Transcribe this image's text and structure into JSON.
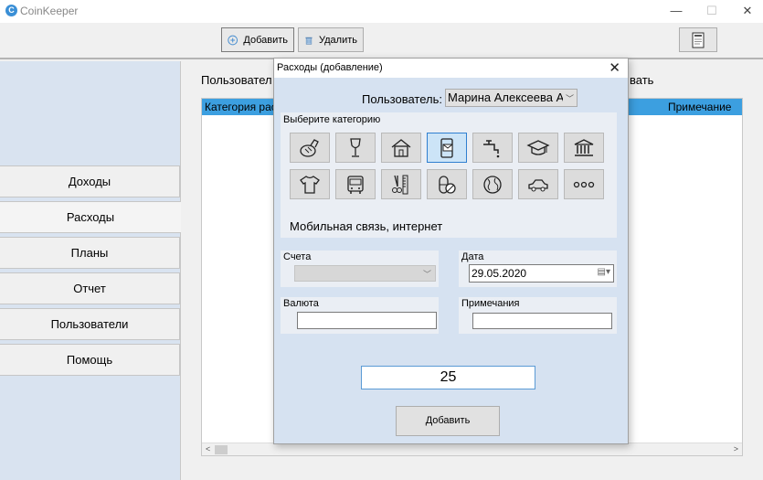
{
  "app": {
    "title": "CoinKeeper",
    "logo_letter": "C"
  },
  "window_controls": {
    "minimize": "—",
    "maximize": "☐",
    "close": "✕"
  },
  "toolbar": {
    "add_label": "Добавить",
    "delete_label": "Удалить"
  },
  "sidebar": {
    "items": [
      {
        "label": "Доходы"
      },
      {
        "label": "Расходы"
      },
      {
        "label": "Планы"
      },
      {
        "label": "Отчет"
      },
      {
        "label": "Пользователи"
      },
      {
        "label": "Помощь"
      }
    ],
    "active_index": 1
  },
  "content": {
    "label_left": "Пользовател",
    "label_right": "вать",
    "grid": {
      "columns": [
        "Категория рас",
        "Примечание"
      ],
      "scroll_left": "<",
      "scroll_right": ">"
    }
  },
  "dialog": {
    "title": "Расходы (добавление)",
    "close": "✕",
    "user_label": "Пользователь:",
    "user_value": "Марина Алексеева Ал",
    "category_label": "Выберите категорию",
    "categories": [
      {
        "icon": "bread-icon"
      },
      {
        "icon": "wine-glass-icon"
      },
      {
        "icon": "house-icon"
      },
      {
        "icon": "mobile-message-icon"
      },
      {
        "icon": "water-tap-icon"
      },
      {
        "icon": "graduation-cap-icon"
      },
      {
        "icon": "bank-icon"
      },
      {
        "icon": "tshirt-icon"
      },
      {
        "icon": "bus-icon"
      },
      {
        "icon": "comb-scissors-icon"
      },
      {
        "icon": "pills-icon"
      },
      {
        "icon": "globe-icon"
      },
      {
        "icon": "car-icon"
      },
      {
        "icon": "more-dots-icon"
      }
    ],
    "selected_category_index": 3,
    "selected_category_name": "Мобильная связь, интернет",
    "accounts_label": "Счета",
    "accounts_value": "",
    "date_label": "Дата",
    "date_value": "29.05.2020",
    "currency_label": "Валюта",
    "currency_value": "",
    "notes_label": "Примечания",
    "notes_value": "",
    "amount_value": "25",
    "submit_label": "Добавить"
  },
  "colors": {
    "accent": "#3c9fe0",
    "sidebar_bg": "#d9e3f0",
    "dialog_bg": "#d6e2f1",
    "selected_category_bg": "#cce4f7"
  }
}
